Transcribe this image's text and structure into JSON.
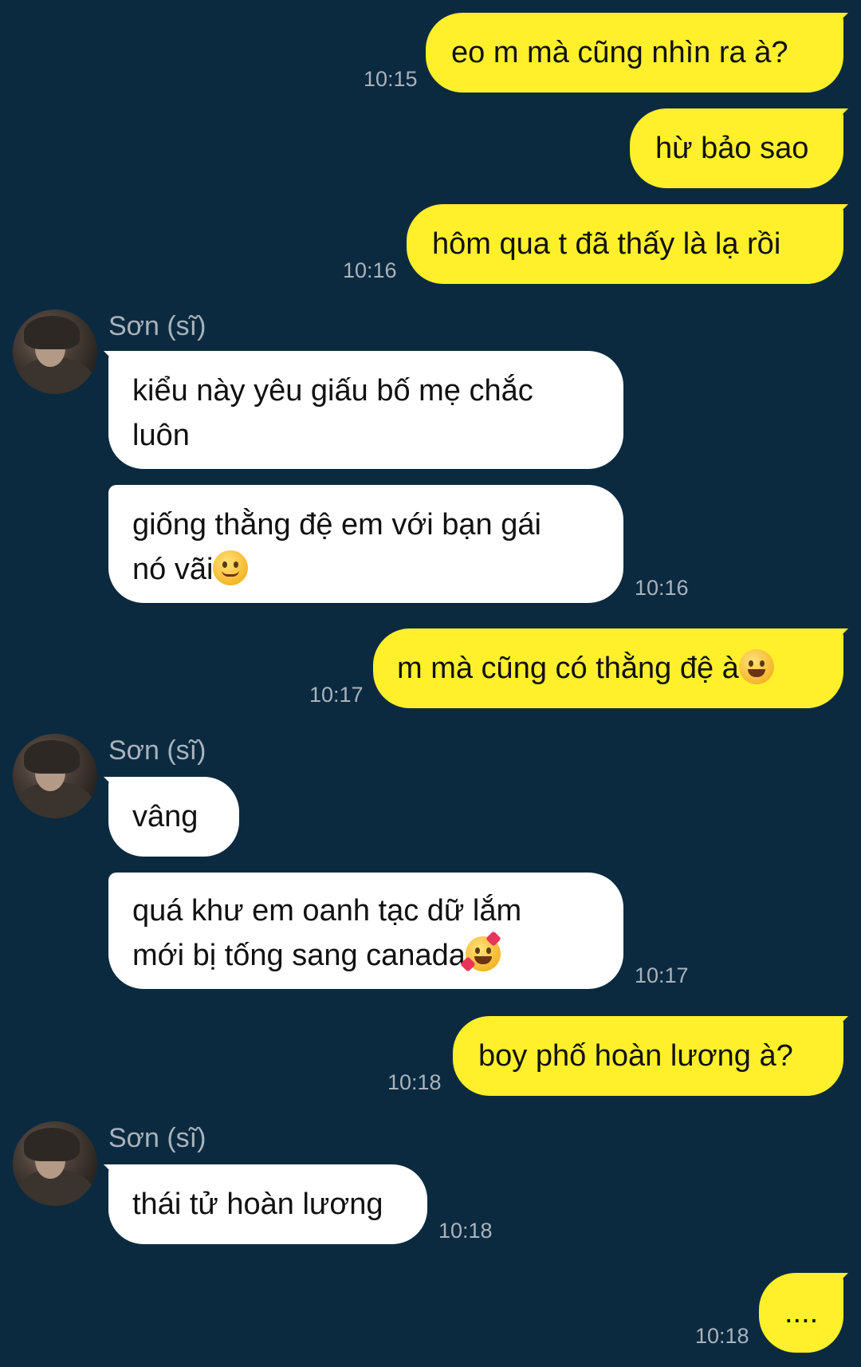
{
  "messages": [
    {
      "text": "eo m mà cũng nhìn ra à?",
      "time": "10:15"
    },
    {
      "text": "hừ bảo sao"
    },
    {
      "text": "hôm qua t đã thấy là lạ rồi",
      "time": "10:16"
    },
    {
      "sender": "Sơn (sĩ)",
      "line1": "kiểu này yêu giấu bố mẹ chắc",
      "line2": "luôn"
    },
    {
      "line1": "giống thằng đệ em với bạn gái",
      "line2": "nó vãi",
      "time": "10:16",
      "emoji": "smiling-face-icon"
    },
    {
      "text": "m mà cũng có thằng đệ à",
      "time": "10:17",
      "emoji": "grinning-face-icon"
    },
    {
      "sender": "Sơn (sĩ)",
      "text": "vâng"
    },
    {
      "line1": "quá khư em oanh tạc dữ lắm",
      "line2": "mới bị tống sang canada",
      "time": "10:17",
      "emoji": "smiling-face-with-hearts-icon"
    },
    {
      "text": "boy phố hoàn lương à?",
      "time": "10:18"
    },
    {
      "sender": "Sơn (sĩ)",
      "text": "thái tử hoàn lương",
      "time": "10:18"
    },
    {
      "text": "....",
      "time": "10:18"
    }
  ],
  "colors": {
    "background": "#0c2a3f",
    "outgoing_bubble": "#fff02b",
    "incoming_bubble": "#ffffff",
    "meta_text": "#a8b3bd"
  }
}
